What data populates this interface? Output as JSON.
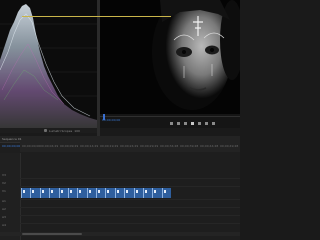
{
  "source_monitor": {
    "scope": "waveform",
    "toolbar": {
      "label_1": "Lumetri Scopes",
      "label_2": "100"
    }
  },
  "program_monitor": {
    "timecode": "00;00;00;00"
  },
  "timeline": {
    "sequence_name": "Sequence 01",
    "timecode": "00;00;00;00",
    "ruler_labels": [
      "00;00;00;00",
      "00;00;04;29",
      "00;00;09;29",
      "00;00;14;29",
      "00;00;19;29",
      "00;00;24;29",
      "00;00;29;29",
      "00;00;34;28",
      "00;00;39;28",
      "00;00;44;28",
      "00;00;49;28"
    ],
    "tracks": [
      "V3",
      "V2",
      "V1",
      "A1",
      "A2",
      "A3",
      "A4"
    ],
    "clip_count": 16
  },
  "colors": {
    "accent": "#3a79d6",
    "clip": "#2f5f9e",
    "workarea": "#c9b54a"
  }
}
